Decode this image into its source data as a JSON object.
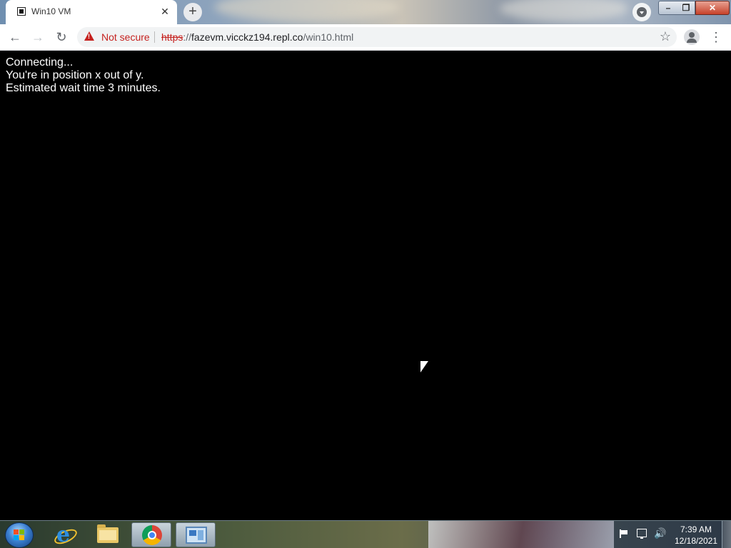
{
  "browser": {
    "tab": {
      "title": "Win10 VM",
      "close_symbol": "✕"
    },
    "new_tab_symbol": "+",
    "window_controls": {
      "minimize": "–",
      "maximize": "❐",
      "close": "✕"
    },
    "toolbar": {
      "back_symbol": "←",
      "forward_symbol": "→",
      "reload_symbol": "↻",
      "security_label": "Not secure",
      "url_scheme": "https",
      "url_rest": "://fazevm.vicckz194.repl.co/win10.html",
      "url_host": "fazevm.vicckz194.repl.co",
      "url_path": "/win10.html",
      "bookmark_symbol": "☆",
      "menu_symbol": "⋮"
    }
  },
  "page": {
    "lines": [
      "Connecting...",
      "You're in position x out of y.",
      "Estimated wait time 3 minutes."
    ],
    "background_color": "#000000",
    "text_color": "#ffffff"
  },
  "taskbar": {
    "apps": [
      {
        "name": "internet-explorer",
        "icon": "ie-icon"
      },
      {
        "name": "file-explorer",
        "icon": "folder-icon"
      },
      {
        "name": "google-chrome",
        "icon": "chrome-icon",
        "active": true
      },
      {
        "name": "remote-desktop",
        "icon": "rdp-icon"
      }
    ],
    "tray": {
      "volume_symbol": "🔊",
      "time": "7:39 AM",
      "date": "12/18/2021"
    }
  }
}
